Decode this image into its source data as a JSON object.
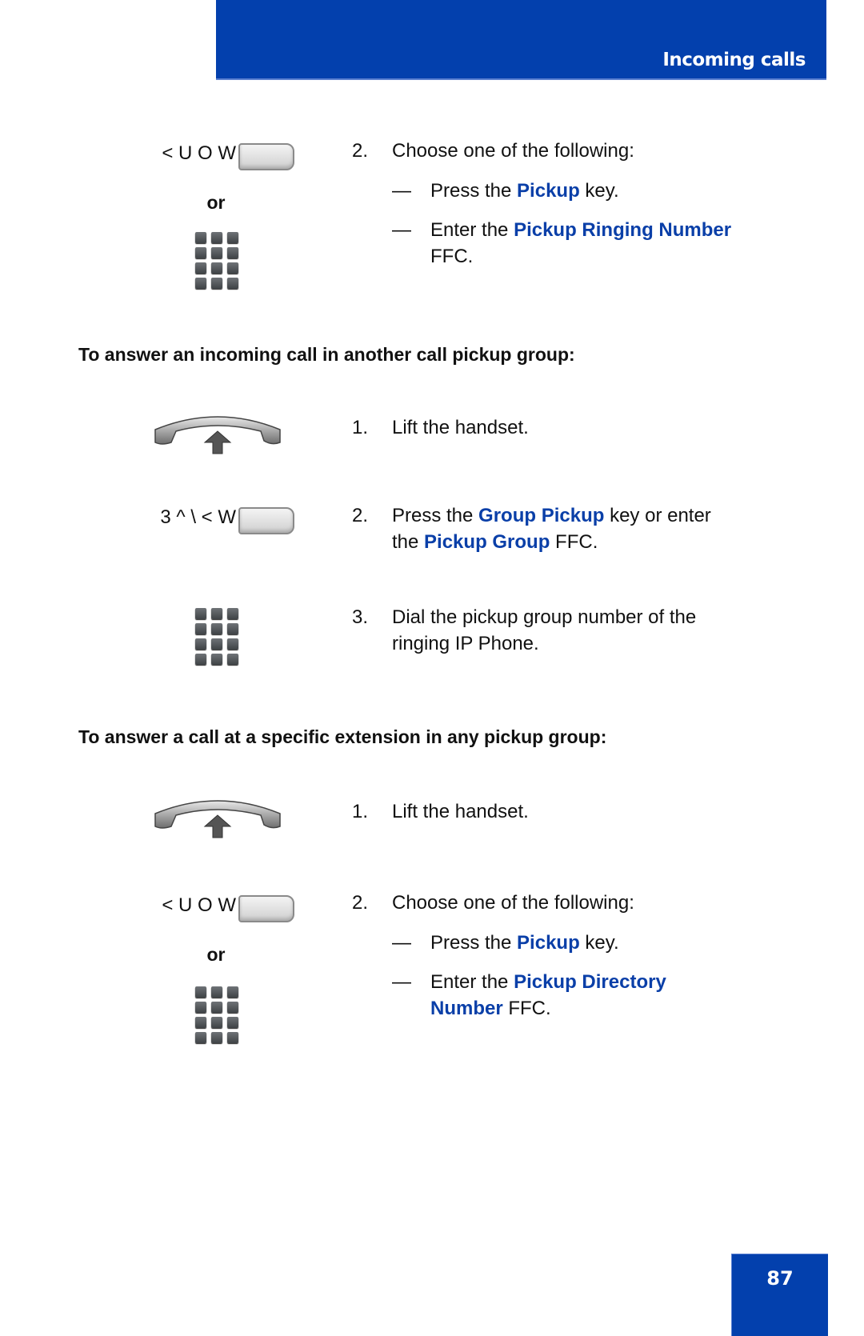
{
  "header": {
    "title": "Incoming calls",
    "accent_color": "#0340ad"
  },
  "page_number": "87",
  "icons": {
    "softkey": "softkey-button-icon",
    "keypad": "dialpad-icon",
    "handset": "lift-handset-icon"
  },
  "section1": {
    "key_label": "< U O W",
    "or_label": "or",
    "step": {
      "number": "2.",
      "text": "Choose one of the following:"
    },
    "options": [
      {
        "dash": "—",
        "pre": "Press the ",
        "highlight": "Pickup",
        "post": " key."
      },
      {
        "dash": "—",
        "pre": "Enter the ",
        "highlight": "Pickup Ringing Number",
        "post": "FFC."
      }
    ]
  },
  "section2": {
    "heading": "To answer an incoming call in another call pickup group:",
    "steps": [
      {
        "number": "1.",
        "text": "Lift the handset."
      },
      {
        "number": "2.",
        "pre": "Press the ",
        "highlight1": "Group Pickup",
        "mid": " key or enter",
        "line2_pre": "the ",
        "highlight2": "Pickup Group",
        "post": " FFC.",
        "key_label": "3 ^ \\ < W"
      },
      {
        "number": "3.",
        "line1": "Dial the pickup group number of the",
        "line2": "ringing IP Phone."
      }
    ]
  },
  "section3": {
    "heading": "To answer a call at a specific extension in any pickup group:",
    "step1": {
      "number": "1.",
      "text": "Lift the handset."
    },
    "key_label": "< U O W",
    "or_label": "or",
    "step2": {
      "number": "2.",
      "text": "Choose one of the following:"
    },
    "options": [
      {
        "dash": "—",
        "pre": "Press the ",
        "highlight": "Pickup",
        "post": " key."
      },
      {
        "dash": "—",
        "pre": "Enter the ",
        "highlight": "Pickup Directory",
        "highlight_line2": "Number",
        "post": " FFC."
      }
    ]
  }
}
